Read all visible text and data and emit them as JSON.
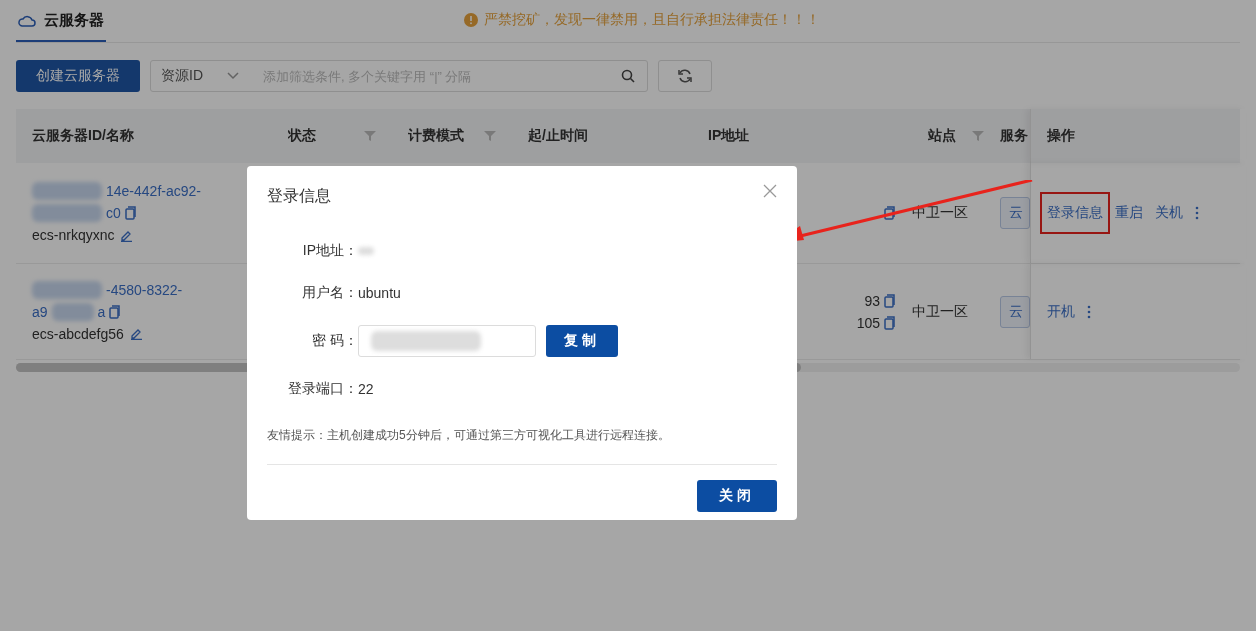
{
  "page_tab": {
    "label": "云服务器",
    "selected": true
  },
  "warning": "严禁挖矿，发现一律禁用，且自行承担法律责任！！！",
  "toolbar": {
    "create_button": "创建云服务器",
    "filter_select": "资源ID",
    "search": {
      "placeholder": "添加筛选条件, 多个关键字用 “|” 分隔"
    }
  },
  "columns": [
    {
      "label": "云服务器ID/名称",
      "filter": false
    },
    {
      "label": "状态",
      "filter": true
    },
    {
      "label": "计费模式",
      "filter": true
    },
    {
      "label": "起/止时间",
      "filter": false
    },
    {
      "label": "IP地址",
      "filter": false
    },
    {
      "label": "站点",
      "filter": true
    },
    {
      "label": "服务",
      "filter": false
    },
    {
      "label": "操作",
      "filter": false
    }
  ],
  "rows": [
    {
      "id_lines": [
        {
          "after": "14e-442f-ac92-"
        },
        {
          "after": "c0"
        }
      ],
      "name": "ecs-nrkqyxnc",
      "site": "中卫一区",
      "service": "云",
      "actions": [
        {
          "label": "登录信息",
          "highlighted": true
        },
        {
          "label": "重启",
          "highlighted": false
        },
        {
          "label": "关机",
          "highlighted": false
        }
      ]
    },
    {
      "id_lines": [
        {
          "after": "-4580-8322-"
        },
        {
          "before": "a9",
          "after": "a"
        }
      ],
      "name": "ecs-abcdefg56",
      "ip_lines": [
        "93",
        "105"
      ],
      "site": "中卫一区",
      "service": "云",
      "actions": [
        {
          "label": "开机",
          "highlighted": false
        }
      ]
    }
  ],
  "dialog": {
    "title": "登录信息",
    "fields": [
      {
        "kind": "blurred",
        "label": "IP地址："
      },
      {
        "kind": "text",
        "label": "用户名：",
        "value": "ubuntu"
      },
      {
        "kind": "password",
        "label": "密 码：",
        "button": "复制"
      },
      {
        "kind": "text",
        "label": "登录端口：",
        "value": "22"
      }
    ],
    "tip": "友情提示：主机创建成功5分钟后，可通过第三方可视化工具进行远程连接。",
    "close_button": "关闭"
  }
}
